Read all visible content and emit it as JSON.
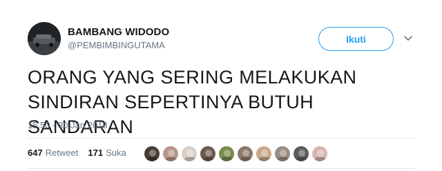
{
  "user": {
    "name": "BAMBANG WIDODO",
    "handle": "@PEMBIMBINGUTAMA"
  },
  "follow_label": "Ikuti",
  "tweet": {
    "text": "ORANG YANG SERING MELAKUKAN SINDIRAN SEPERTINYA BUTUH SANDARAN",
    "timestamp": "15.50 - 30 Jan 2018"
  },
  "stats": {
    "retweets_count": "647",
    "retweets_label": "Retweet",
    "likes_count": "171",
    "likes_label": "Suka"
  },
  "colors": {
    "accent": "#1da1f2",
    "secondary_text": "#657786",
    "primary_text": "#14171a"
  },
  "icons": {
    "caret": "chevron-down-icon"
  },
  "liker_colors": [
    "#4a3b35",
    "#b8948a",
    "#d9d0c8",
    "#6b5a4e",
    "#7a8a4f",
    "#8c7a6a",
    "#c9a88e",
    "#9a8d83",
    "#5c5c5c",
    "#d8b6b0"
  ]
}
